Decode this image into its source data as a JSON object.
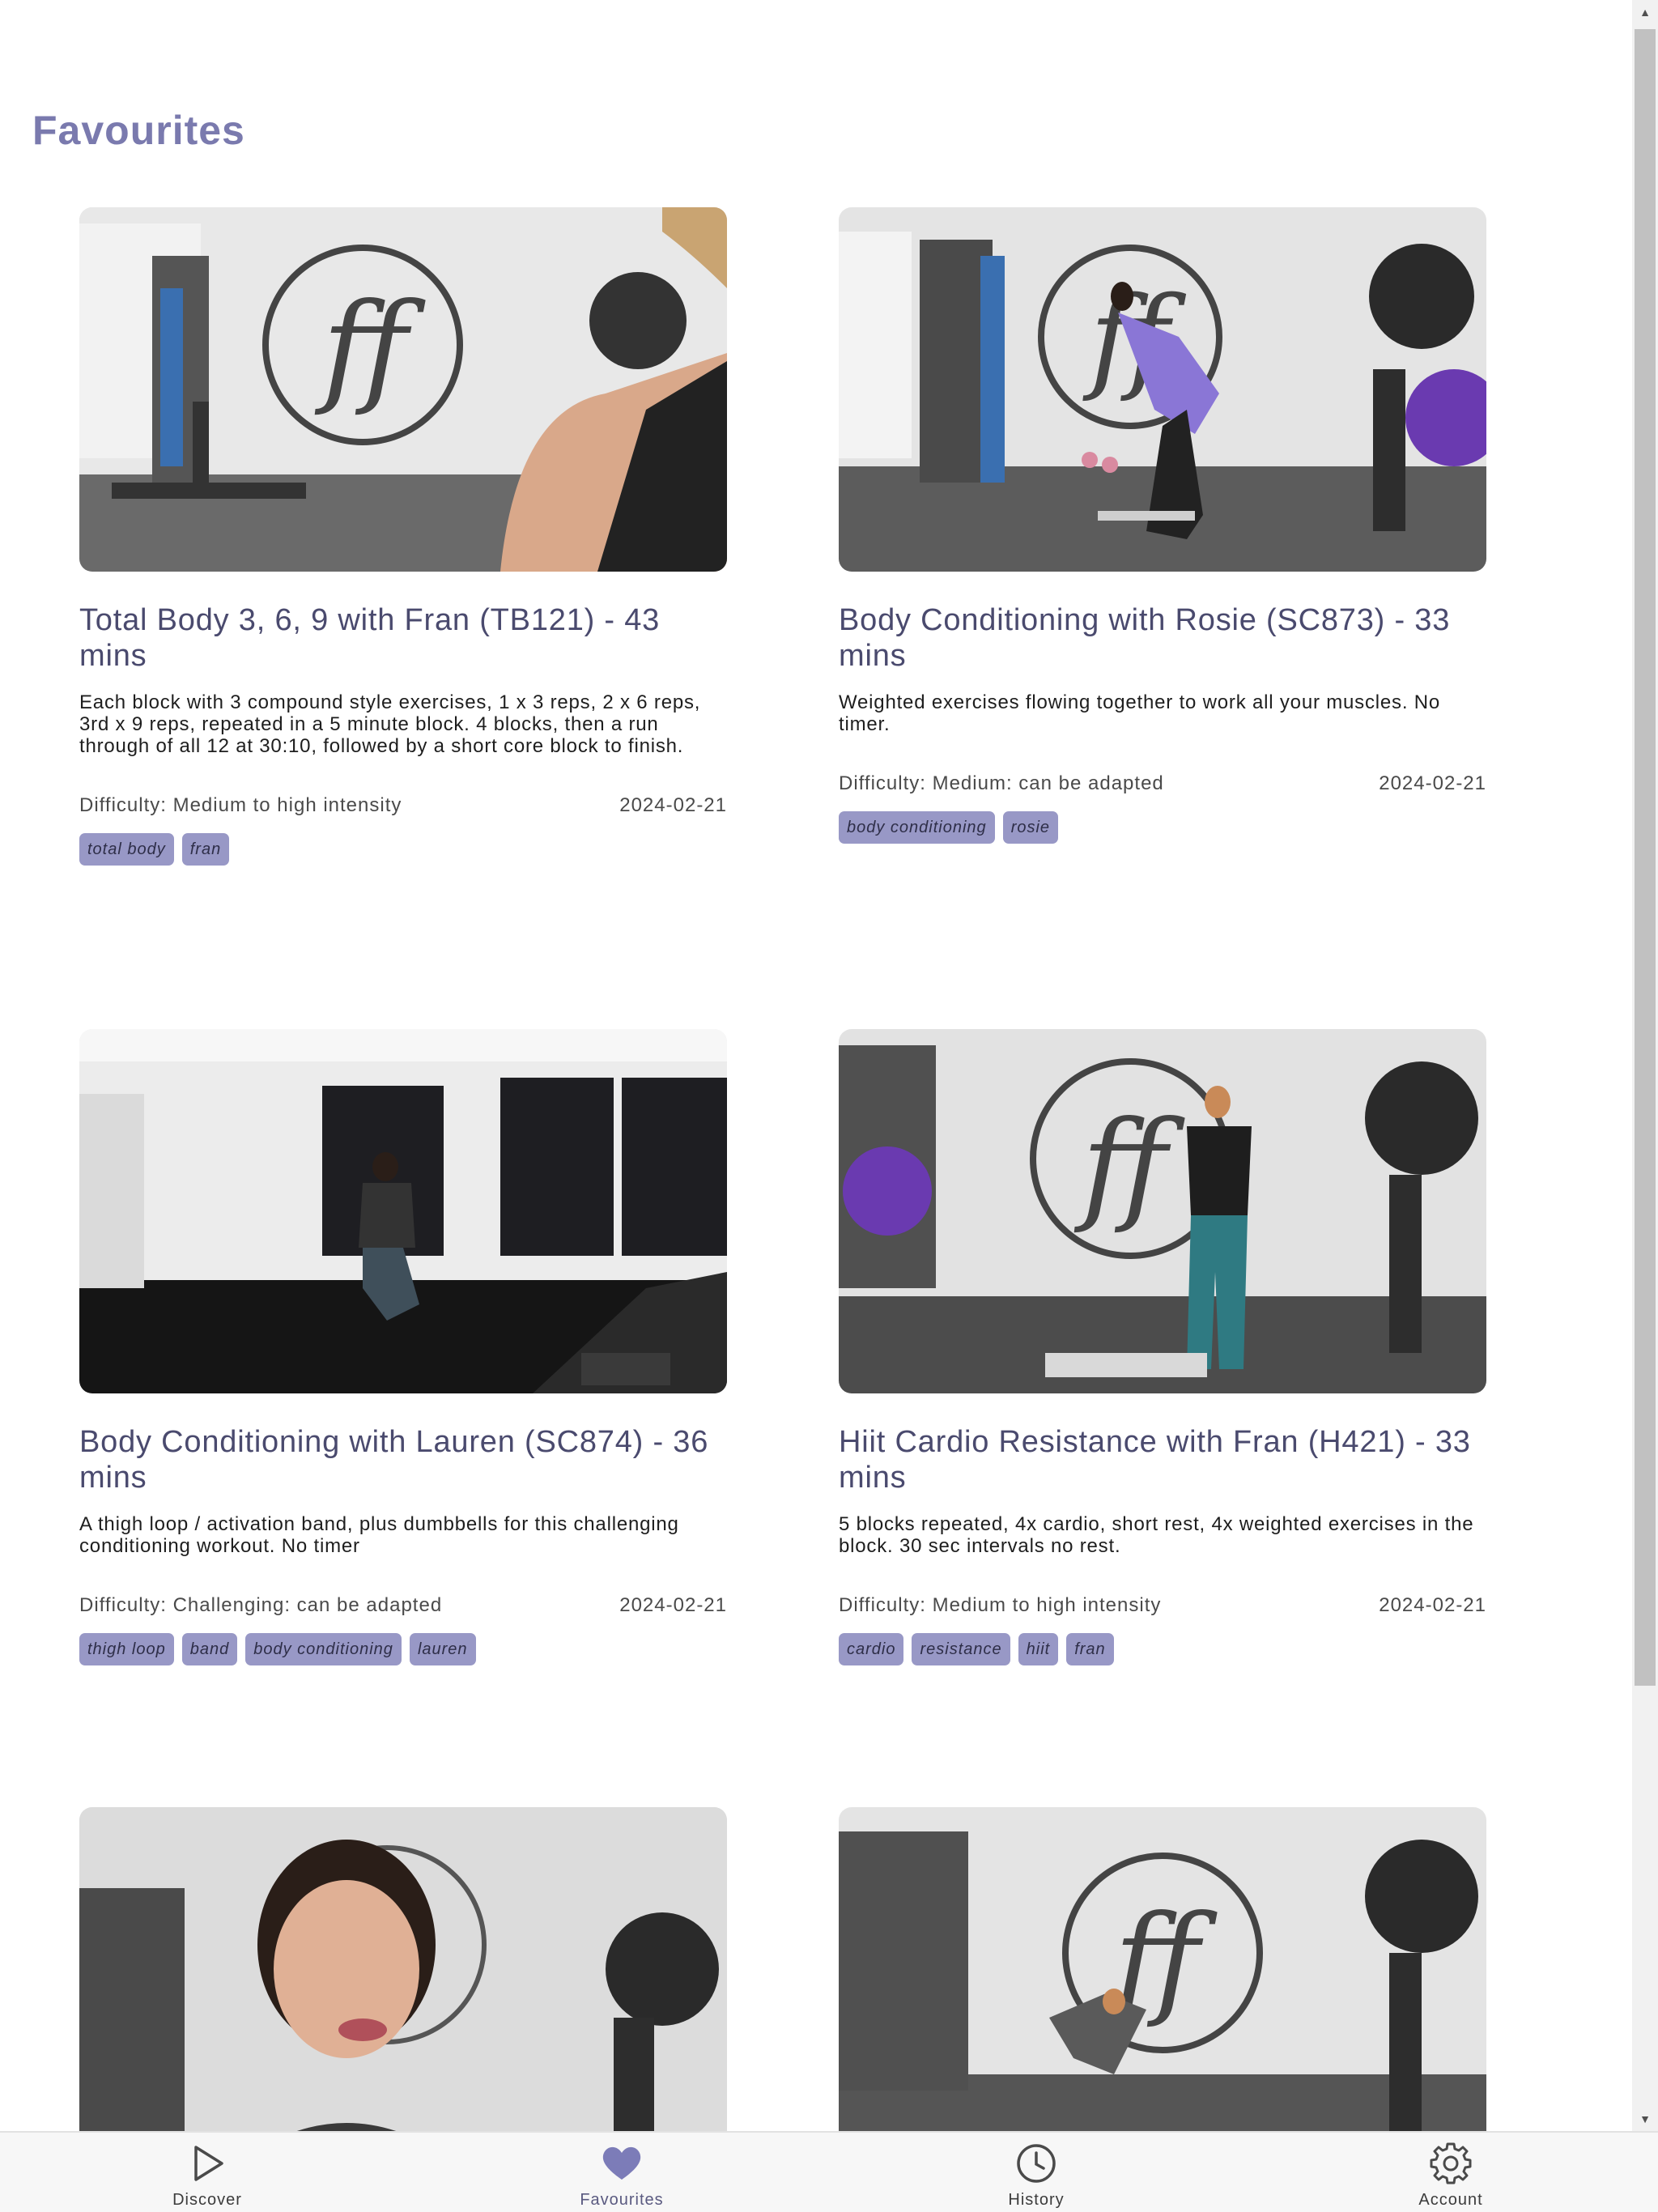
{
  "page": {
    "title": "Favourites"
  },
  "colors": {
    "accent": "#7a7aae",
    "tag_bg": "#9898c6",
    "heart": "#7c7cb8"
  },
  "cards": [
    {
      "title": "Total Body 3, 6, 9 with Fran (TB121) - 43 mins",
      "description": "Each block with 3 compound style exercises, 1 x 3 reps, 2 x 6 reps, 3rd x 9 reps, repeated in a 5 minute block. 4 blocks, then a run through of all 12 at 30:10, followed by a short core block to finish.",
      "difficulty": "Difficulty: Medium to high intensity",
      "date": "2024-02-21",
      "tags": [
        "total body",
        "fran"
      ]
    },
    {
      "title": "Body Conditioning with Rosie (SC873) - 33 mins",
      "description": "Weighted exercises flowing together to work all your muscles. No timer.",
      "difficulty": "Difficulty: Medium: can be adapted",
      "date": "2024-02-21",
      "tags": [
        "body conditioning",
        "rosie"
      ]
    },
    {
      "title": "Body Conditioning with Lauren (SC874) - 36 mins",
      "description": "A thigh loop / activation band, plus dumbbells for this challenging conditioning workout. No timer",
      "difficulty": "Difficulty: Challenging: can be adapted",
      "date": "2024-02-21",
      "tags": [
        "thigh loop",
        "band",
        "body conditioning",
        "lauren"
      ]
    },
    {
      "title": "Hiit Cardio Resistance with Fran (H421) - 33 mins",
      "description": "5 blocks repeated, 4x cardio, short rest, 4x weighted exercises in the block. 30 sec intervals no rest.",
      "difficulty": "Difficulty: Medium to high intensity",
      "date": "2024-02-21",
      "tags": [
        "cardio",
        "resistance",
        "hiit",
        "fran"
      ]
    },
    {
      "title": "",
      "description": "",
      "difficulty": "",
      "date": "",
      "tags": []
    },
    {
      "title": "",
      "description": "",
      "difficulty": "",
      "date": "",
      "tags": []
    }
  ],
  "nav": {
    "items": [
      {
        "label": "Discover",
        "icon": "play-icon"
      },
      {
        "label": "Favourites",
        "icon": "heart-icon",
        "active": true
      },
      {
        "label": "History",
        "icon": "clock-icon"
      },
      {
        "label": "Account",
        "icon": "gear-icon"
      }
    ]
  }
}
